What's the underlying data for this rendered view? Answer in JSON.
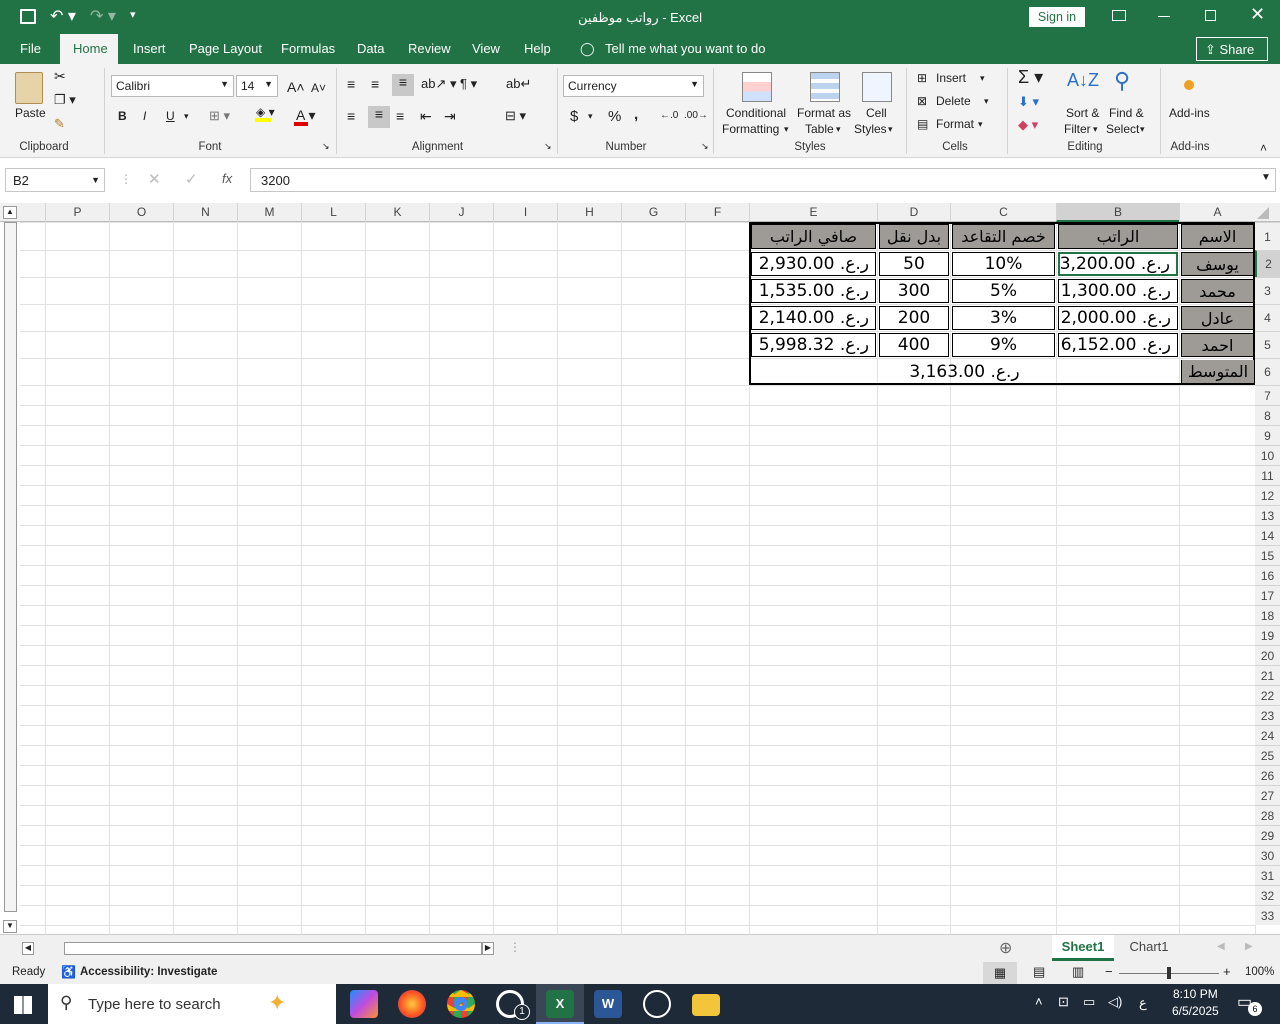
{
  "window": {
    "title": "رواتب موظفين  -  Excel",
    "signin": "Sign in",
    "share": "Share"
  },
  "tabs": [
    "File",
    "Home",
    "Insert",
    "Page Layout",
    "Formulas",
    "Data",
    "Review",
    "View",
    "Help"
  ],
  "tell_me": "Tell me what you want to do",
  "ribbon": {
    "clipboard": {
      "label": "Clipboard",
      "paste": "Paste"
    },
    "font": {
      "label": "Font",
      "name": "Calibri",
      "size": "14",
      "bold": "B",
      "italic": "I",
      "underline": "U"
    },
    "alignment": {
      "label": "Alignment"
    },
    "number": {
      "label": "Number",
      "format": "Currency",
      "dollar": "$",
      "percent": "%",
      "comma": ","
    },
    "styles": {
      "label": "Styles",
      "conditional": [
        "Conditional",
        "Formatting"
      ],
      "format_table": [
        "Format as",
        "Table"
      ],
      "cell_styles": [
        "Cell",
        "Styles"
      ]
    },
    "cells": {
      "label": "Cells",
      "insert": "Insert",
      "delete": "Delete",
      "format": "Format"
    },
    "editing": {
      "label": "Editing",
      "sort": [
        "Sort &",
        "Filter"
      ],
      "find": [
        "Find &",
        "Select"
      ]
    },
    "addins": {
      "label": "Add-ins",
      "button": "Add-ins"
    }
  },
  "formula_bar": {
    "name_box": "B2",
    "fx": "fx",
    "value": "3200"
  },
  "columns": [
    "P",
    "O",
    "N",
    "M",
    "L",
    "K",
    "J",
    "I",
    "H",
    "G",
    "F",
    "E",
    "D",
    "C",
    "B",
    "A"
  ],
  "rows": [
    "1",
    "2",
    "3",
    "4",
    "5",
    "6",
    "7",
    "8",
    "9",
    "10",
    "11",
    "12",
    "13",
    "14",
    "15",
    "16",
    "17",
    "18",
    "19",
    "20",
    "21",
    "22",
    "23",
    "24",
    "25",
    "26",
    "27",
    "28",
    "29",
    "30",
    "31",
    "32",
    "33"
  ],
  "table": {
    "headers": {
      "A": "الاسم",
      "B": "الراتب",
      "C": "خصم التقاعد",
      "D": "بدل نقل",
      "E": "صافي الراتب"
    },
    "rows": [
      {
        "A": "يوسف",
        "B": "ر.ع. 3,200.00",
        "C": "10%",
        "D": "50",
        "E": "ر.ع. 2,930.00"
      },
      {
        "A": "محمد",
        "B": "ر.ع. 1,300.00",
        "C": "5%",
        "D": "300",
        "E": "ر.ع. 1,535.00"
      },
      {
        "A": "عادل",
        "B": "ر.ع. 2,000.00",
        "C": "3%",
        "D": "200",
        "E": "ر.ع. 2,140.00"
      },
      {
        "A": "احمد",
        "B": "ر.ع. 6,152.00",
        "C": "9%",
        "D": "400",
        "E": "ر.ع. 5,998.32"
      }
    ],
    "average": {
      "label": "المتوسط",
      "value": "ر.ع. 3,163.00"
    }
  },
  "sheet_tabs": [
    "Sheet1",
    "Chart1"
  ],
  "status": {
    "ready": "Ready",
    "accessibility": "Accessibility: Investigate",
    "zoom": "100%"
  },
  "taskbar": {
    "search": "Type here to search",
    "time": "8:10 PM",
    "date": "6/5/2025",
    "lang": "ع",
    "notif": "6",
    "whatsapp_badge": "1"
  },
  "colors": {
    "excel_green": "#217346",
    "header_fill": "#9e9a96",
    "taskbar": "#1f2a38"
  }
}
